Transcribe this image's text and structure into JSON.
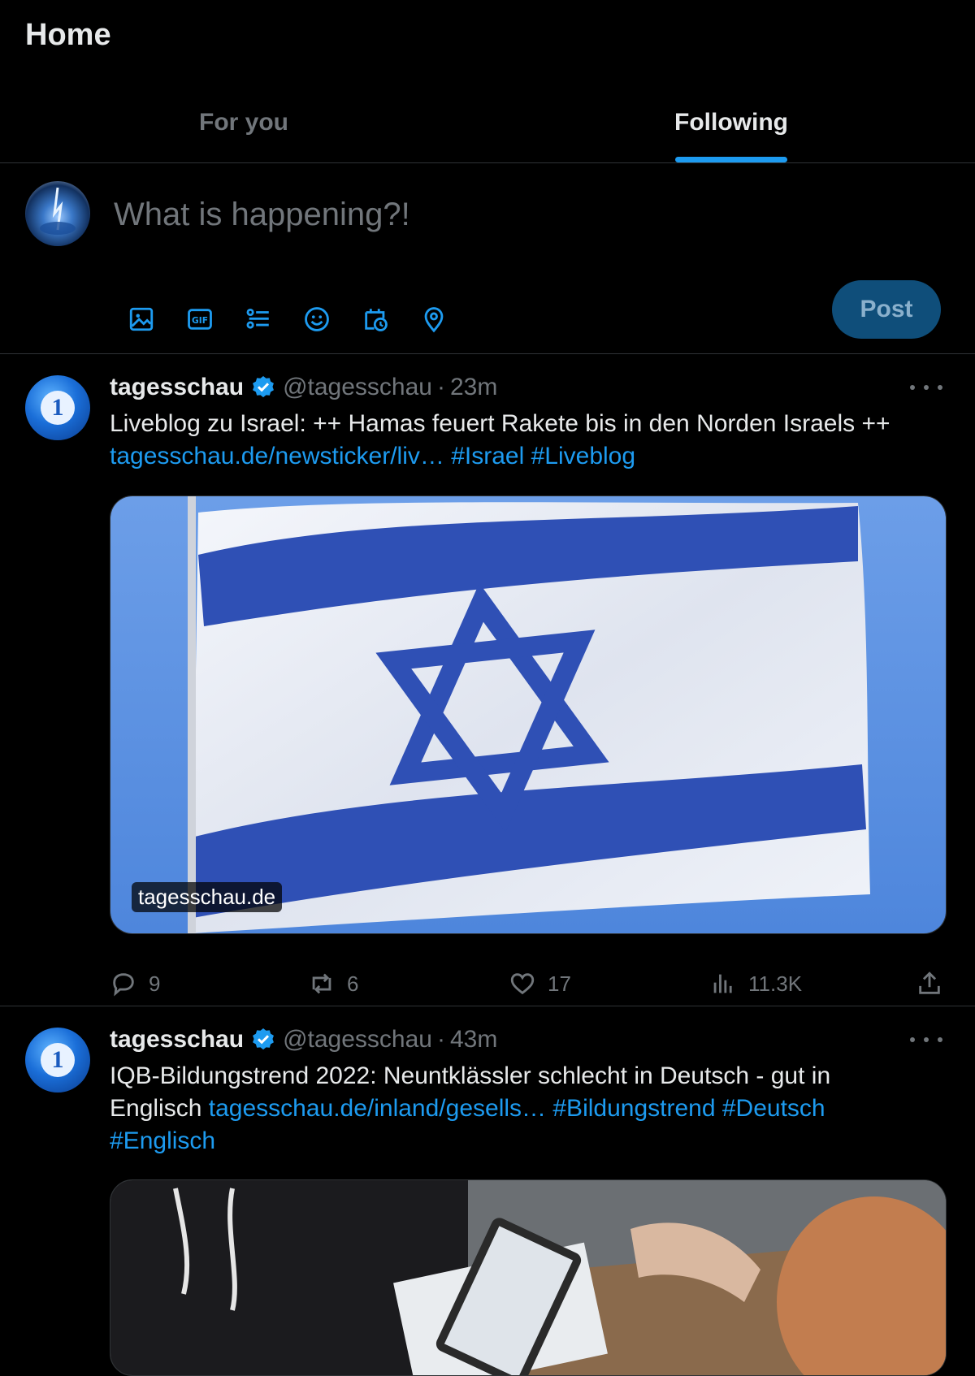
{
  "header": {
    "title": "Home",
    "tabs": [
      {
        "label": "For you",
        "active": false
      },
      {
        "label": "Following",
        "active": true
      }
    ]
  },
  "composer": {
    "placeholder": "What is happening?!",
    "tools": [
      "image-icon",
      "gif-icon",
      "poll-icon",
      "emoji-icon",
      "schedule-icon",
      "location-icon"
    ],
    "post_label": "Post"
  },
  "colors": {
    "accent": "#1d9bf0",
    "background": "#000000",
    "muted": "#71767b",
    "border": "#2f3336"
  },
  "tweets": [
    {
      "name": "tagesschau",
      "handle": "@tagesschau",
      "dot": "·",
      "time": "23m",
      "text": "Liveblog zu Israel: ++ Hamas feuert Rakete bis in den Norden Israels ++",
      "link": "tagesschau.de/newsticker/liv…",
      "hashtags": [
        "#Israel",
        "#Liveblog"
      ],
      "media_label": "tagesschau.de",
      "replies": "9",
      "reposts": "6",
      "likes": "17",
      "views": "11.3K"
    },
    {
      "name": "tagesschau",
      "handle": "@tagesschau",
      "dot": "·",
      "time": "43m",
      "text_a": "IQB-Bildungstrend 2022: Neuntklässler schlecht in Deutsch - gut in",
      "text_b": "Englisch",
      "link": "tagesschau.de/inland/gesells…",
      "hashtags": [
        "#Bildungstrend",
        "#Deutsch",
        "#Englisch"
      ]
    }
  ]
}
